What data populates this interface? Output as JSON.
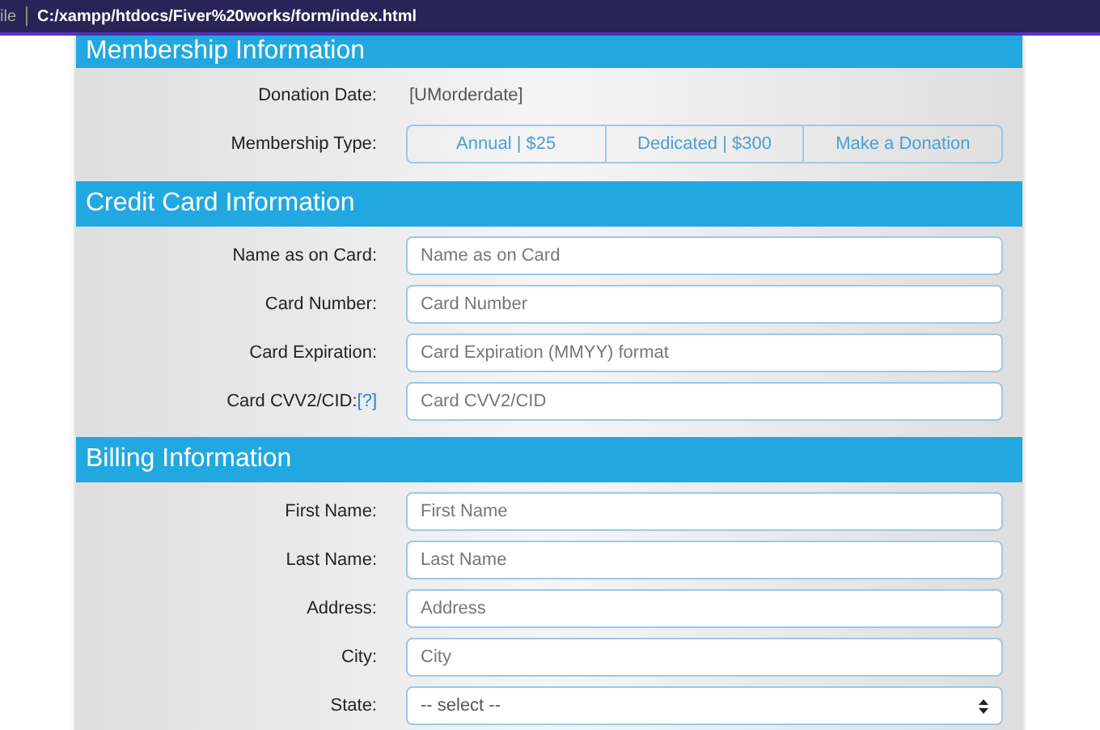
{
  "browser": {
    "menu_fragment": "ile",
    "url": "C:/xampp/htdocs/Fiver%20works/form/index.html"
  },
  "sections": [
    {
      "title": "Membership Information",
      "rows": [
        {
          "kind": "text",
          "label": "Donation Date:",
          "value": "[UMorderdate]"
        },
        {
          "kind": "segmented",
          "label": "Membership Type:",
          "options": [
            {
              "label": "Annual | $25",
              "selected": false
            },
            {
              "label": "Dedicated | $300",
              "selected": false
            },
            {
              "label": "Make a Donation",
              "selected": false
            }
          ]
        }
      ]
    },
    {
      "title": "Credit Card Information",
      "rows": [
        {
          "kind": "input",
          "label": "Name as on Card:",
          "placeholder": "Name as on Card"
        },
        {
          "kind": "input",
          "label": "Card Number:",
          "placeholder": "Card Number"
        },
        {
          "kind": "input",
          "label": "Card Expiration:",
          "placeholder": "Card Expiration (MMYY) format"
        },
        {
          "kind": "input",
          "label": "Card CVV2/CID:",
          "link": "[?]",
          "placeholder": "Card CVV2/CID"
        }
      ]
    },
    {
      "title": "Billing Information",
      "rows": [
        {
          "kind": "input",
          "label": "First Name:",
          "placeholder": "First Name"
        },
        {
          "kind": "input",
          "label": "Last Name:",
          "placeholder": "Last Name"
        },
        {
          "kind": "input",
          "label": "Address:",
          "placeholder": "Address"
        },
        {
          "kind": "input",
          "label": "City:",
          "placeholder": "City"
        },
        {
          "kind": "select",
          "label": "State:",
          "value": "-- select --"
        }
      ]
    }
  ]
}
